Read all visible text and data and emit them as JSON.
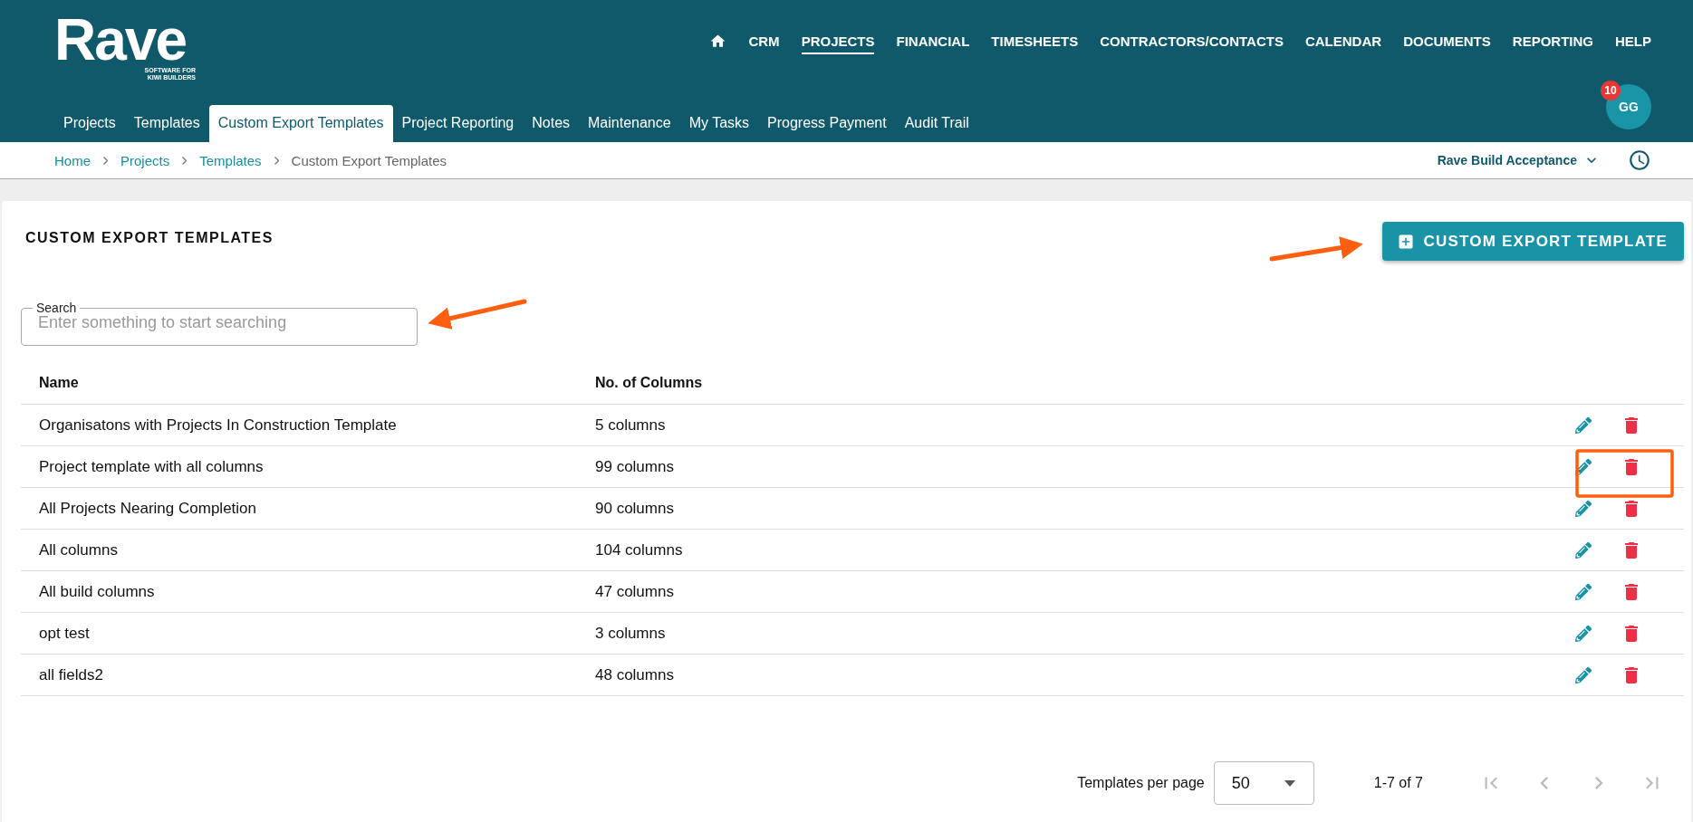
{
  "logo": {
    "name": "Rave",
    "tagline": [
      "SOFTWARE FOR",
      "KIWI BUILDERS"
    ]
  },
  "top_nav": [
    {
      "label": "CRM",
      "selected": false
    },
    {
      "label": "PROJECTS",
      "selected": true
    },
    {
      "label": "FINANCIAL",
      "selected": false
    },
    {
      "label": "TIMESHEETS",
      "selected": false
    },
    {
      "label": "CONTRACTORS/CONTACTS",
      "selected": false
    },
    {
      "label": "CALENDAR",
      "selected": false
    },
    {
      "label": "DOCUMENTS",
      "selected": false
    },
    {
      "label": "REPORTING",
      "selected": false
    },
    {
      "label": "HELP",
      "selected": false
    }
  ],
  "tabs": [
    {
      "label": "Projects",
      "selected": false
    },
    {
      "label": "Templates",
      "selected": false
    },
    {
      "label": "Custom Export Templates",
      "selected": true
    },
    {
      "label": "Project Reporting",
      "selected": false
    },
    {
      "label": "Notes",
      "selected": false
    },
    {
      "label": "Maintenance",
      "selected": false
    },
    {
      "label": "My Tasks",
      "selected": false
    },
    {
      "label": "Progress Payment",
      "selected": false
    },
    {
      "label": "Audit Trail",
      "selected": false
    }
  ],
  "user": {
    "initials": "GG",
    "notifications": "10"
  },
  "breadcrumb": [
    {
      "label": "Home",
      "current": false
    },
    {
      "label": "Projects",
      "current": false
    },
    {
      "label": "Templates",
      "current": false
    },
    {
      "label": "Custom Export Templates",
      "current": true
    }
  ],
  "company": "Rave Build Acceptance",
  "page": {
    "title": "CUSTOM EXPORT TEMPLATES",
    "add_button": "CUSTOM EXPORT TEMPLATE"
  },
  "search": {
    "label": "Search",
    "placeholder": "Enter something to start searching"
  },
  "table": {
    "columns": [
      "Name",
      "No. of Columns"
    ],
    "rows": [
      {
        "name": "Organisatons with Projects In Construction Template",
        "columns": "5 columns"
      },
      {
        "name": "Project template with all columns",
        "columns": "99 columns"
      },
      {
        "name": "All Projects Nearing Completion",
        "columns": "90 columns"
      },
      {
        "name": "All columns",
        "columns": "104 columns"
      },
      {
        "name": "All build columns",
        "columns": "47 columns"
      },
      {
        "name": "opt test",
        "columns": "3 columns"
      },
      {
        "name": "all fields2",
        "columns": "48 columns"
      }
    ]
  },
  "pagination": {
    "per_page_label": "Templates per page",
    "per_page": "50",
    "range": "1-7 of 7",
    "first_disabled": true,
    "prev_disabled": true,
    "next_disabled": true,
    "last_disabled": true
  }
}
